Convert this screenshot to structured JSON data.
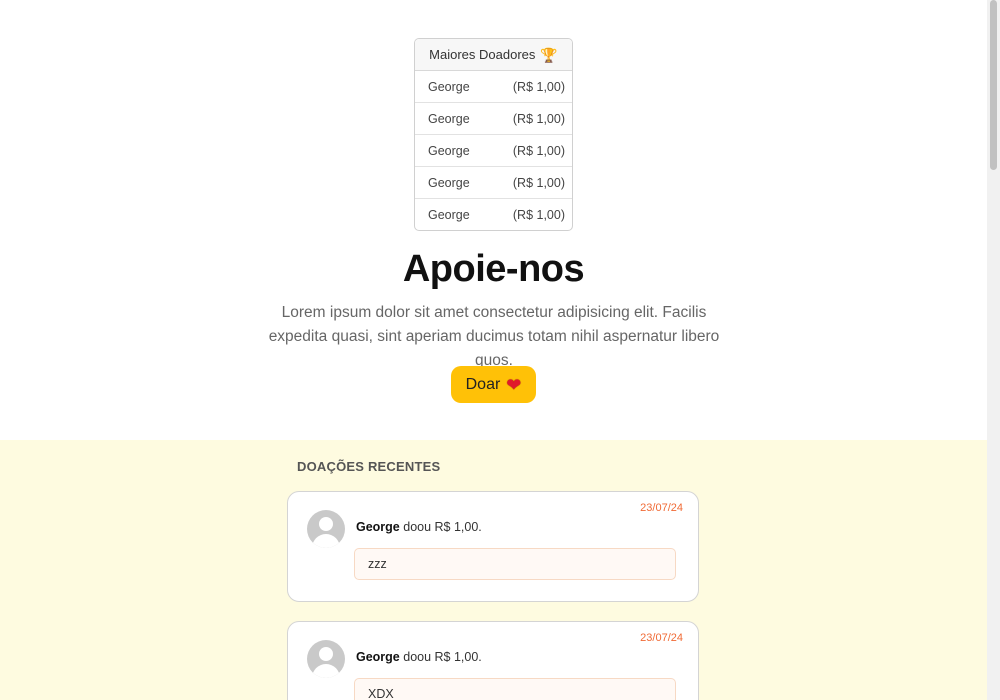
{
  "top_donors": {
    "title": "Maiores Doadores",
    "trophy_icon": "🏆",
    "rows": [
      {
        "name": "George",
        "amount": "(R$ 1,00)"
      },
      {
        "name": "George",
        "amount": "(R$ 1,00)"
      },
      {
        "name": "George",
        "amount": "(R$ 1,00)"
      },
      {
        "name": "George",
        "amount": "(R$ 1,00)"
      },
      {
        "name": "George",
        "amount": "(R$ 1,00)"
      }
    ]
  },
  "hero": {
    "title": "Apoie-nos",
    "text": "Lorem ipsum dolor sit amet consectetur adipisicing elit. Facilis expedita quasi, sint aperiam ducimus totam nihil aspernatur libero quos.",
    "button_label": "Doar",
    "heart_icon": "❤"
  },
  "recent": {
    "title": "DOAÇÕES RECENTES",
    "items": [
      {
        "date": "23/07/24",
        "name": "George",
        "action": " doou R$ 1,00.",
        "message": "zzz"
      },
      {
        "date": "23/07/24",
        "name": "George",
        "action": " doou R$ 1,00.",
        "message": "XDX"
      }
    ]
  },
  "colors": {
    "accent": "#ffc107",
    "section_bg": "#fefbe0",
    "date": "#f06a35"
  }
}
